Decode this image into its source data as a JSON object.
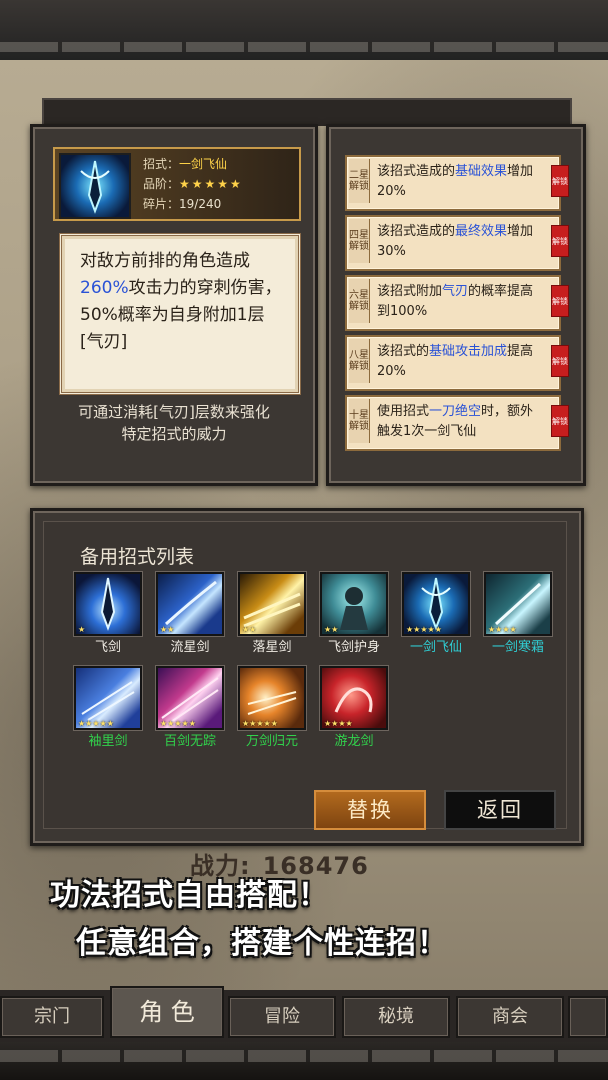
{
  "skill_detail": {
    "name_label": "招式：",
    "name": "一剑飞仙",
    "rank_label": "品阶：",
    "rank_stars": "★★★★★",
    "fragments_label": "碎片：",
    "fragments": "19/240",
    "desc_parts": [
      "对敌方前排的角色造成",
      "260%",
      "攻击力的穿刺伤害，50%概率为自身附加1层[气刃]"
    ],
    "strengthen_note_1": "可通过消耗[气刃]层数来强化",
    "strengthen_note_2": "特定招式的威力"
  },
  "unlocks": [
    {
      "tag": "二星解锁",
      "pre": "该招式造成的",
      "hl": "基础效果",
      "post": "增加20%",
      "badge": "解锁"
    },
    {
      "tag": "四星解锁",
      "pre": "该招式造成的",
      "hl": "最终效果",
      "post": "增加30%",
      "badge": "解锁"
    },
    {
      "tag": "六星解锁",
      "pre": "该招式附加",
      "hl": "气刃",
      "post": "的概率提高到100%",
      "badge": "解锁"
    },
    {
      "tag": "八星解锁",
      "pre": "该招式的",
      "hl": "基础攻击加成",
      "post": "提高20%",
      "badge": "解锁"
    },
    {
      "tag": "十星解锁",
      "pre": "使用招式",
      "hl": "一刀绝空",
      "post": "时，额外触发1次一剑飞仙",
      "badge": "解锁"
    }
  ],
  "skill_list": {
    "title": "备用招式列表",
    "items": [
      {
        "name": "飞剑",
        "stars": "★",
        "color": "#f0ece4"
      },
      {
        "name": "流星剑",
        "stars": "★★",
        "color": "#f0ece4"
      },
      {
        "name": "落星剑",
        "stars": "★★",
        "color": "#f0ece4"
      },
      {
        "name": "飞剑护身",
        "stars": "★★",
        "color": "#f0ece4"
      },
      {
        "name": "一剑飞仙",
        "stars": "★★★★★",
        "color": "#2fd0d6"
      },
      {
        "name": "一剑寒霜",
        "stars": "★★★★",
        "color": "#2fd0d6"
      },
      {
        "name": "袖里剑",
        "stars": "★★★★★",
        "color": "#31d24c"
      },
      {
        "name": "百剑无踪",
        "stars": "★★★★★",
        "color": "#31d24c"
      },
      {
        "name": "万剑归元",
        "stars": "★★★★★",
        "color": "#31d24c"
      },
      {
        "name": "游龙剑",
        "stars": "★★★★",
        "color": "#31d24c"
      }
    ],
    "replace_label": "替换",
    "back_label": "返回"
  },
  "power": {
    "label": "战力:",
    "value": "168476"
  },
  "promo": {
    "line1": "功法招式自由搭配！",
    "line2": "任意组合，搭建个性连招！"
  },
  "nav": {
    "tabs": [
      "宗门",
      "角 色",
      "冒险",
      "秘境",
      "商会"
    ],
    "active": "角 色"
  }
}
